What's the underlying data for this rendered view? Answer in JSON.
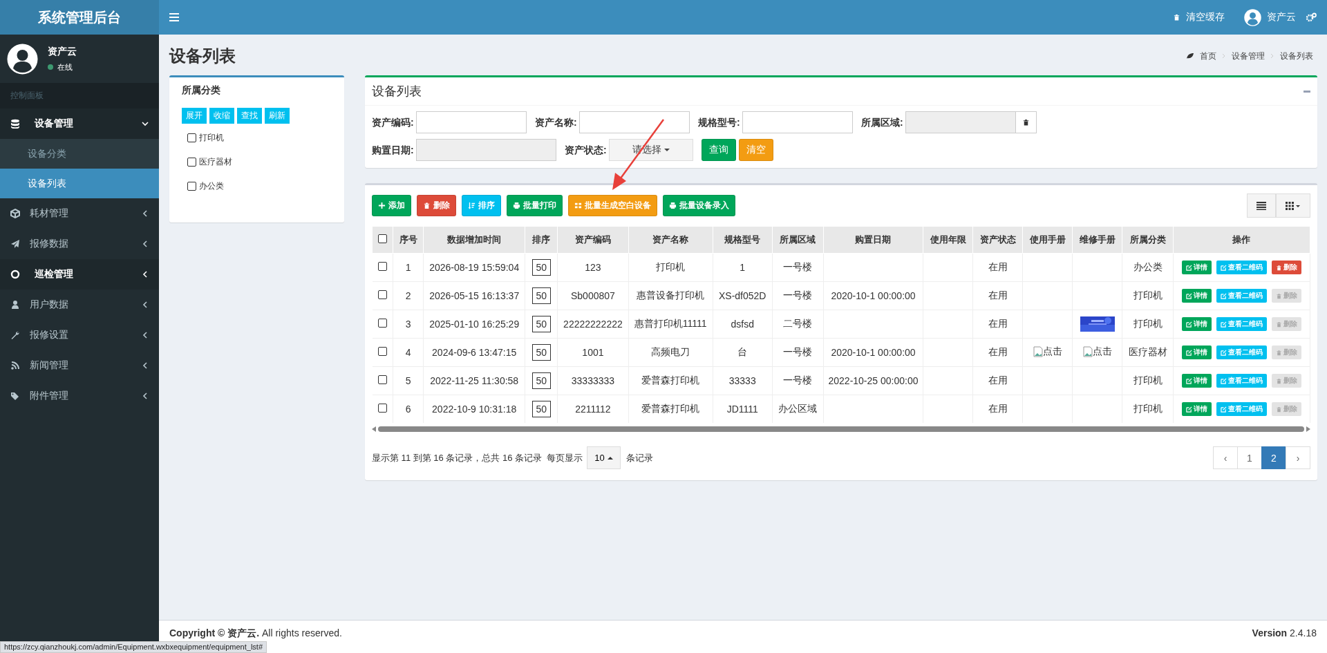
{
  "brand": "系统管理后台",
  "topbar": {
    "clear_cache": "清空缓存",
    "user": "资产云"
  },
  "user_panel": {
    "name": "资产云",
    "status": "在线",
    "online": true
  },
  "sidebar": {
    "header": "控制面板",
    "items": [
      {
        "label": "设备管理",
        "active": true,
        "expanded": true,
        "children": [
          {
            "label": "设备分类",
            "selected": false
          },
          {
            "label": "设备列表",
            "selected": true
          }
        ]
      },
      {
        "label": "耗材管理",
        "active": false,
        "expanded": false
      },
      {
        "label": "报修数据",
        "active": false,
        "expanded": false
      },
      {
        "label": "巡检管理",
        "active": true,
        "expanded": false
      },
      {
        "label": "用户数据",
        "active": false,
        "expanded": false
      },
      {
        "label": "报修设置",
        "active": false,
        "expanded": false
      },
      {
        "label": "新闻管理",
        "active": false,
        "expanded": false
      },
      {
        "label": "附件管理",
        "active": false,
        "expanded": false
      }
    ]
  },
  "page_title": "设备列表",
  "breadcrumb": [
    "首页",
    "设备管理",
    "设备列表"
  ],
  "category_panel": {
    "title": "所属分类",
    "buttons": [
      "展开",
      "收缩",
      "查找",
      "刷新"
    ],
    "items": [
      {
        "label": "打印机",
        "checked": false
      },
      {
        "label": "医疗器材",
        "checked": false
      },
      {
        "label": "办公类",
        "checked": false
      }
    ]
  },
  "filter_panel": {
    "title": "设备列表",
    "fields": [
      {
        "label": "资产编码:",
        "kind": "text"
      },
      {
        "label": "资产名称:",
        "kind": "text"
      },
      {
        "label": "规格型号:",
        "kind": "text"
      },
      {
        "label": "所属区域:",
        "kind": "clearable"
      },
      {
        "label": "购置日期:",
        "kind": "readonly"
      },
      {
        "label": "资产状态:",
        "kind": "select",
        "value": "请选择"
      }
    ],
    "buttons": [
      {
        "label": "查询",
        "color": "#00a65a"
      },
      {
        "label": "清空",
        "color": "#f39c12"
      }
    ]
  },
  "toolbar": [
    {
      "label": "添加",
      "color": "#00a65a"
    },
    {
      "label": "删除",
      "color": "#dd4b39"
    },
    {
      "label": "排序",
      "color": "#00c0ef"
    },
    {
      "label": "批量打印",
      "color": "#00a65a"
    },
    {
      "label": "批量生成空白设备",
      "color": "#f39c12"
    },
    {
      "label": "批量设备录入",
      "color": "#00a65a"
    }
  ],
  "table": {
    "columns": [
      "序号",
      "数据增加时间",
      "排序",
      "资产编码",
      "资产名称",
      "规格型号",
      "所属区域",
      "购置日期",
      "使用年限",
      "资产状态",
      "使用手册",
      "维修手册",
      "所属分类",
      "操作"
    ],
    "select_all_checked": false,
    "rows": [
      {
        "checked": false,
        "no": "1",
        "time": "2026-08-19 15:59:04",
        "sort": "50",
        "code": "123",
        "name": "打印机",
        "model": "1",
        "area": "一号楼",
        "date": "",
        "years": "",
        "status": "在用",
        "manual_use": null,
        "manual_repair": null,
        "category": "办公类",
        "delete_enabled": true,
        "actions": {
          "detail": "详情",
          "qrcode": "查看二维码",
          "delete": "删除"
        }
      },
      {
        "checked": false,
        "no": "2",
        "time": "2026-05-15 16:13:37",
        "sort": "50",
        "code": "Sb000807",
        "name": "惠普设备打印机",
        "model": "XS-df052D",
        "area": "一号楼",
        "date": "2020-10-1 00:00:00",
        "years": "",
        "status": "在用",
        "manual_use": null,
        "manual_repair": null,
        "category": "打印机",
        "delete_enabled": false,
        "actions": {
          "detail": "详情",
          "qrcode": "查看二维码",
          "delete": "删除"
        }
      },
      {
        "checked": false,
        "no": "3",
        "time": "2025-01-10 16:25:29",
        "sort": "50",
        "code": "22222222222",
        "name": "惠普打印机11111",
        "model": "dsfsd",
        "area": "二号楼",
        "date": "",
        "years": "",
        "status": "在用",
        "manual_use": null,
        "category": "打印机",
        "delete_enabled": false,
        "actions": {
          "detail": "详情",
          "qrcode": "查看二维码",
          "delete": "删除"
        }
      },
      {
        "checked": false,
        "no": "4",
        "time": "2024-09-6 13:47:15",
        "sort": "50",
        "code": "1001",
        "name": "高频电刀",
        "model": "台",
        "area": "一号楼",
        "date": "2020-10-1 00:00:00",
        "years": "",
        "status": "在用",
        "manual_use": {
          "kind": "broken",
          "alt": "点击"
        },
        "manual_repair": {
          "kind": "broken",
          "alt": "点击"
        },
        "category": "医疗器材",
        "delete_enabled": false,
        "actions": {
          "detail": "详情",
          "qrcode": "查看二维码",
          "delete": "删除"
        }
      },
      {
        "checked": false,
        "no": "5",
        "time": "2022-11-25 11:30:58",
        "sort": "50",
        "code": "33333333",
        "name": "爱普森打印机",
        "model": "33333",
        "area": "一号楼",
        "date": "2022-10-25 00:00:00",
        "years": "",
        "status": "在用",
        "manual_use": null,
        "manual_repair": null,
        "category": "打印机",
        "delete_enabled": false,
        "actions": {
          "detail": "详情",
          "qrcode": "查看二维码",
          "delete": "删除"
        }
      },
      {
        "checked": false,
        "no": "6",
        "time": "2022-10-9 10:31:18",
        "sort": "50",
        "code": "2211112",
        "name": "爱普森打印机",
        "model": "JD1111",
        "area": "办公区域",
        "date": "",
        "years": "",
        "status": "在用",
        "manual_use": null,
        "manual_repair": null,
        "category": "打印机",
        "delete_enabled": false,
        "actions": {
          "detail": "详情",
          "qrcode": "查看二维码",
          "delete": "删除"
        }
      }
    ]
  },
  "pagination": {
    "summary": "显示第 11 到第 16 条记录，总共 16 条记录",
    "per_page_label": "每页显示",
    "per_page": "10",
    "per_page_suffix": "条记录",
    "pages": [
      {
        "label": "‹",
        "selected": false
      },
      {
        "label": "1",
        "selected": false
      },
      {
        "label": "2",
        "selected": true
      },
      {
        "label": "›",
        "selected": false
      }
    ]
  },
  "footer": {
    "copyright": "**Copyright © 资产云.** All rights reserved.",
    "version": "**Version** 2.4.18"
  },
  "status_url": "https://zcy.qianzhoukj.com/admin/Equipment.wxbxequipment/equipment_lst#"
}
